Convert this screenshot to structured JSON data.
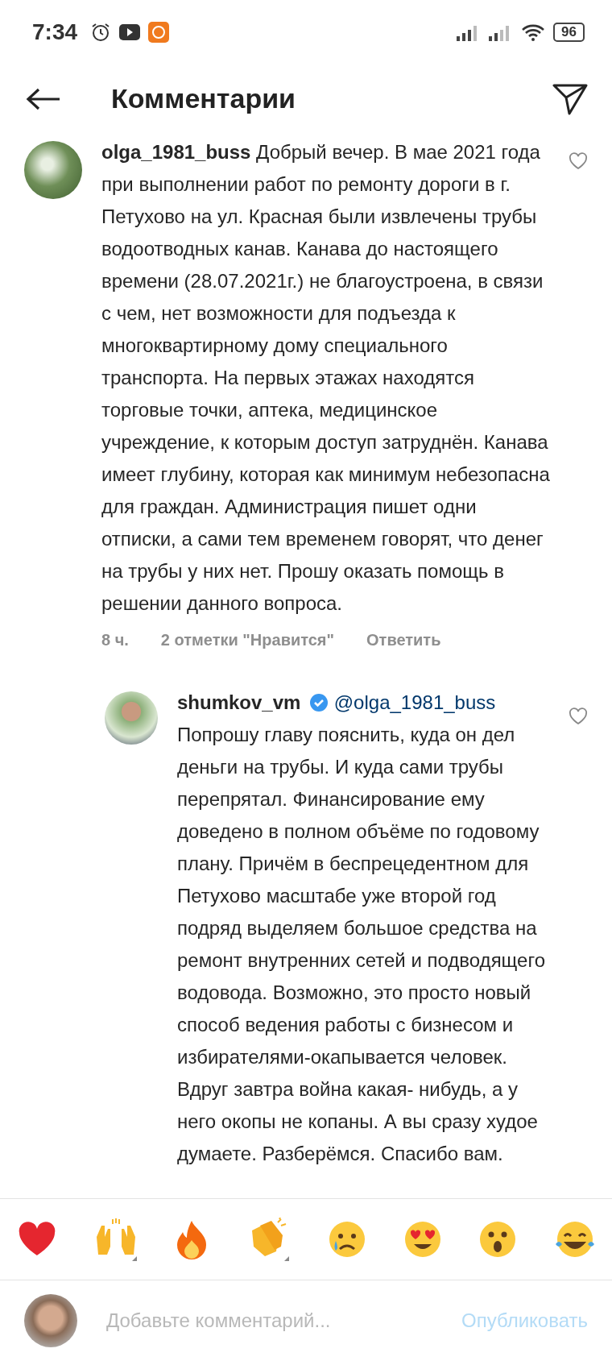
{
  "status_bar": {
    "time": "7:34",
    "battery": "96"
  },
  "header": {
    "title": "Комментарии"
  },
  "comments": [
    {
      "username": "olga_1981_buss",
      "verified": false,
      "liked": false,
      "text": "Добрый вечер. В мае 2021 года при выполнении работ по ремонту дороги в г. Петухово на ул. Красная были извлечены трубы водоотводных канав. Канава до настоящего времени (28.07.2021г.) не благоустроена, в связи с чем, нет возможности для подъезда к многоквартирному дому специального транспорта. На первых этажах находятся торговые точки, аптека, медицинское учреждение, к которым доступ затруднён. Канава имеет глубину, которая как минимум небезопасна для граждан. Администрация пишет одни отписки, а сами тем временем говорят, что денег на трубы у них нет. Прошу оказать помощь в решении данного вопроса.",
      "time": "8 ч.",
      "likes": "2 отметки \"Нравится\"",
      "reply": "Ответить",
      "replies": [
        {
          "username": "shumkov_vm",
          "verified": true,
          "liked": false,
          "mention": "@olga_1981_buss",
          "text": "Попрошу главу пояснить, куда он дел деньги на трубы. И куда сами трубы перепрятал. Финансирование ему доведено в полном объёме по годовому плану. Причём в беспрецедентном для Петухово масштабе уже второй год подряд выделяем большое средства на ремонт внутренних сетей и подводящего водовода. Возможно, это  просто новый способ ведения работы с бизнесом и избирателями-окапывается человек. Вдруг завтра война какая- нибудь, а у него окопы не копаны. А вы сразу худое думаете. Разберёмся. Спасибо вам."
        }
      ]
    }
  ],
  "composer": {
    "placeholder": "Добавьте комментарий...",
    "post_button": "Опубликовать"
  }
}
